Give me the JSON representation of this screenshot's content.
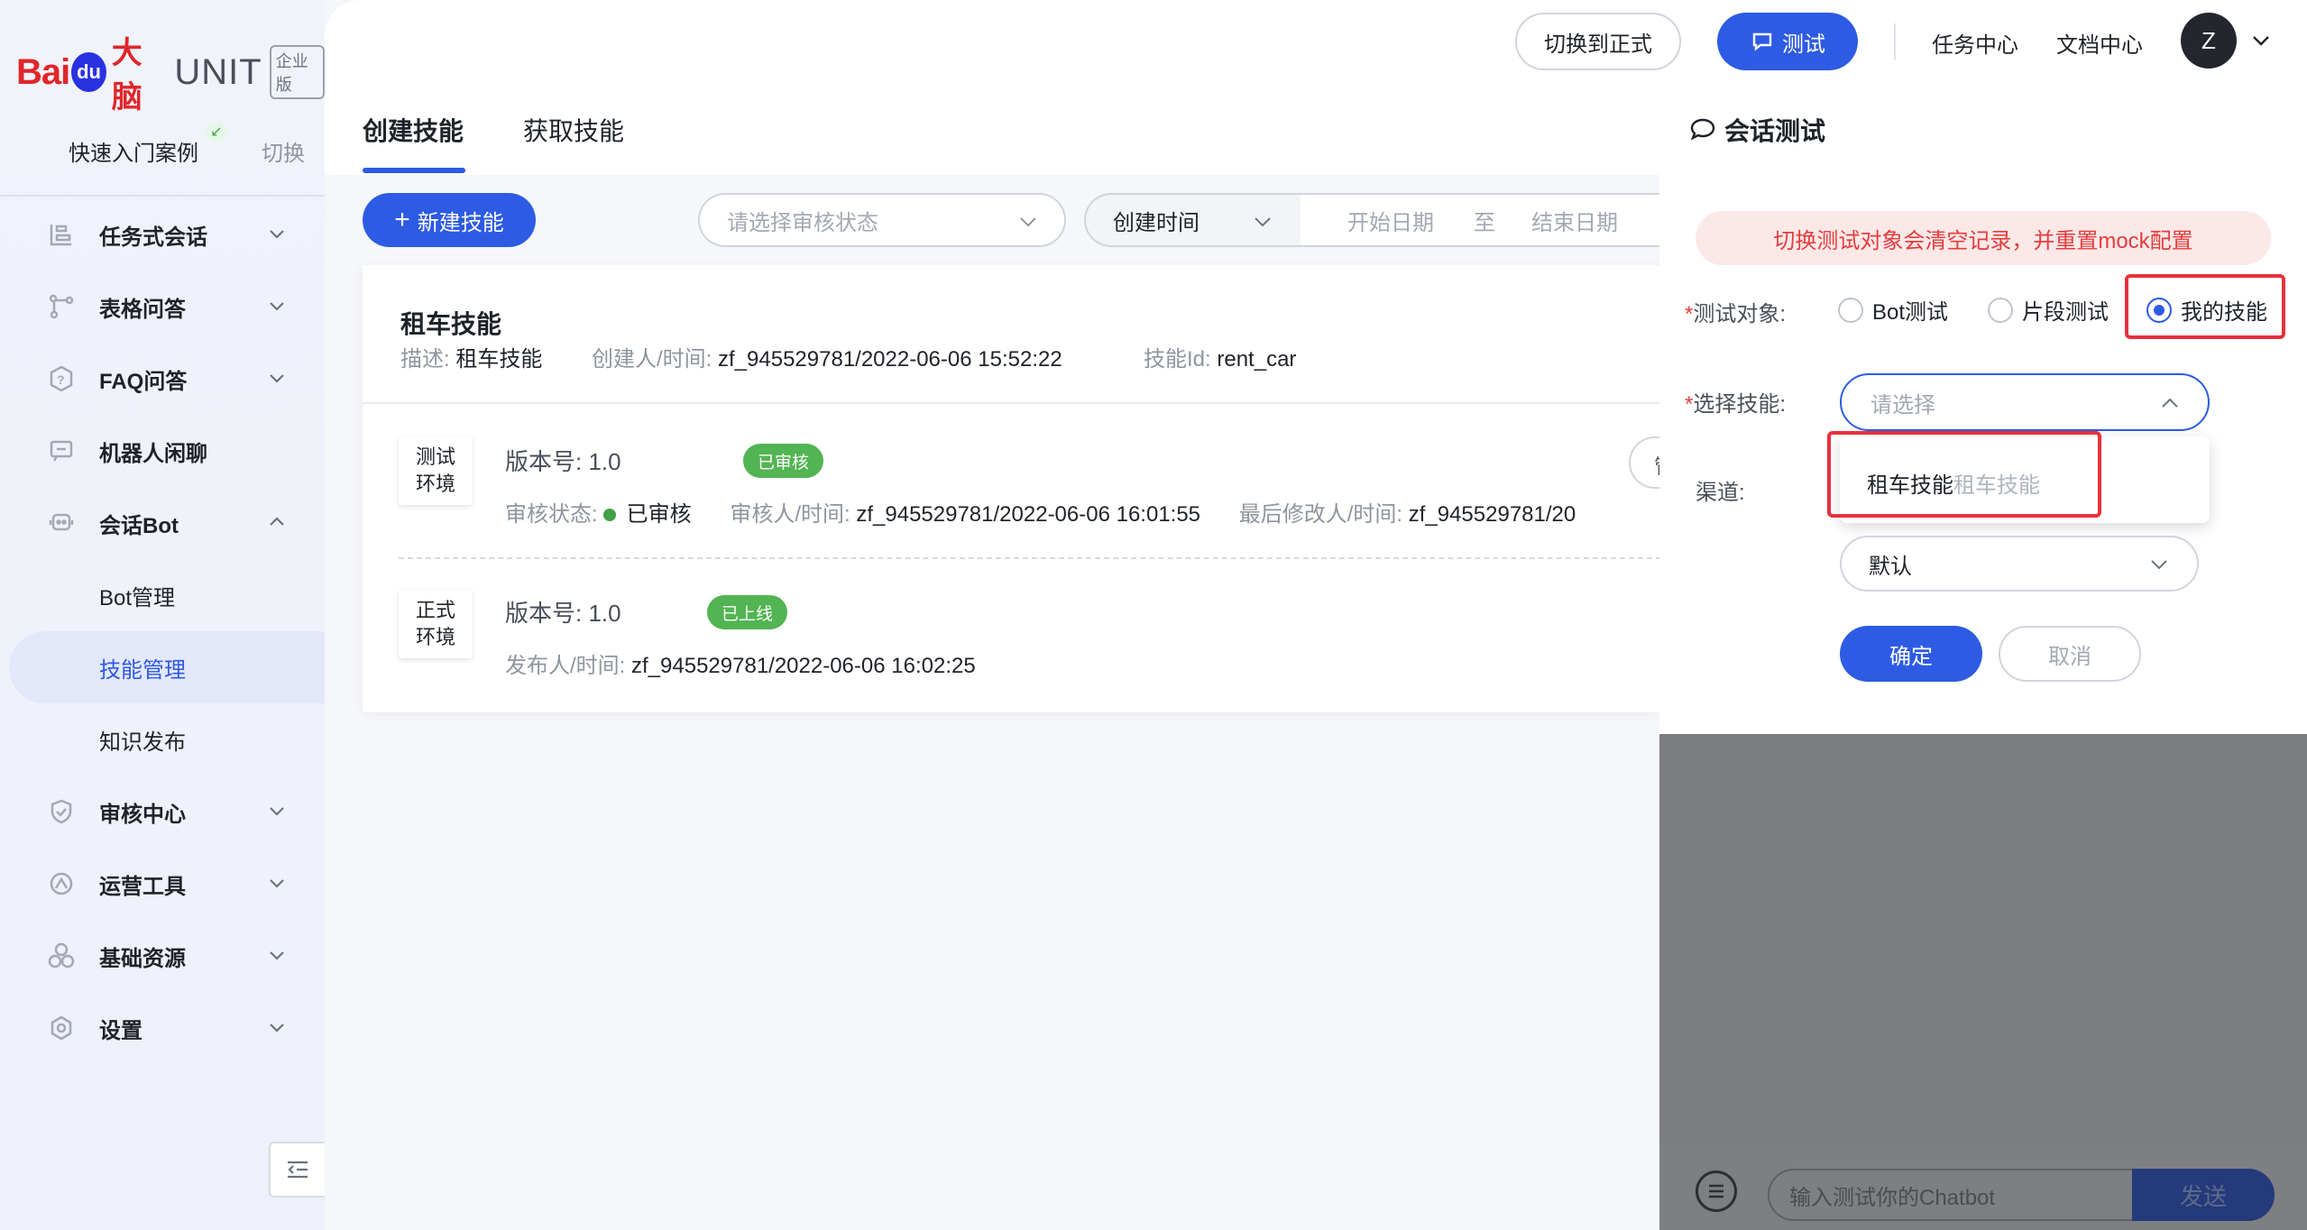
{
  "sidebar": {
    "logo": {
      "bai": "Bai",
      "du": "du",
      "danao": "大脑",
      "unit": "UNIT",
      "edition": "企业版"
    },
    "quick_start": "快速入门案例",
    "switch": "切换",
    "items": [
      {
        "label": "任务式会话",
        "icon": "task-dialog-icon"
      },
      {
        "label": "表格问答",
        "icon": "table-qa-icon"
      },
      {
        "label": "FAQ问答",
        "icon": "faq-icon"
      },
      {
        "label": "机器人闲聊",
        "icon": "chat-icon"
      },
      {
        "label": "会话Bot",
        "icon": "bot-icon"
      },
      {
        "label": "审核中心",
        "icon": "shield-icon"
      },
      {
        "label": "运营工具",
        "icon": "ops-icon"
      },
      {
        "label": "基础资源",
        "icon": "resource-icon"
      },
      {
        "label": "设置",
        "icon": "settings-icon"
      }
    ],
    "sub_items": [
      "Bot管理",
      "技能管理",
      "知识发布"
    ]
  },
  "topbar": {
    "switch_formal": "切换到正式",
    "test": "测试",
    "task_center": "任务中心",
    "doc_center": "文档中心",
    "avatar": "Z"
  },
  "tabs": [
    "创建技能",
    "获取技能"
  ],
  "toolbar": {
    "new_skill": "新建技能",
    "status_placeholder": "请选择审核状态",
    "time_type": "创建时间",
    "start_date": "开始日期",
    "range_sep": "至",
    "end_date": "结束日期"
  },
  "skill": {
    "name": "租车技能",
    "desc_label": "描述:",
    "desc": "租车技能",
    "creator_label": "创建人/时间:",
    "creator": "zf_945529781/2022-06-06 15:52:22",
    "id_label": "技能Id:",
    "id": "rent_car",
    "envs": [
      {
        "env": [
          "测试",
          "环境"
        ],
        "version_label": "版本号:",
        "version": "1.0",
        "badge": "已审核",
        "status_label": "审核状态:",
        "status": "已审核",
        "reviewer_label": "审核人/时间:",
        "reviewer": "zf_945529781/2022-06-06 16:01:55",
        "modifier_label": "最后修改人/时间:",
        "modifier": "zf_945529781/20",
        "action": "管"
      },
      {
        "env": [
          "正式",
          "环境"
        ],
        "version_label": "版本号:",
        "version": "1.0",
        "badge": "已上线",
        "publisher_label": "发布人/时间:",
        "publisher": "zf_945529781/2022-06-06 16:02:25"
      }
    ]
  },
  "panel": {
    "title": "会话测试",
    "alert": "切换测试对象会清空记录，并重置mock配置",
    "target_label": "测试对象:",
    "targets": [
      "Bot测试",
      "片段测试",
      "我的技能"
    ],
    "selected_target": "我的技能",
    "skill_label": "选择技能:",
    "skill_placeholder": "请选择",
    "dropdown_option_main": "租车技能",
    "dropdown_option_sub": "租车技能",
    "channel_label": "渠道:",
    "channel_value": "默认",
    "ok": "确定",
    "cancel": "取消"
  },
  "chat": {
    "placeholder": "输入测试你的Chatbot",
    "send": "发送"
  },
  "colors": {
    "primary": "#2d5be3",
    "danger": "#e43d3d",
    "success": "#52b452"
  }
}
